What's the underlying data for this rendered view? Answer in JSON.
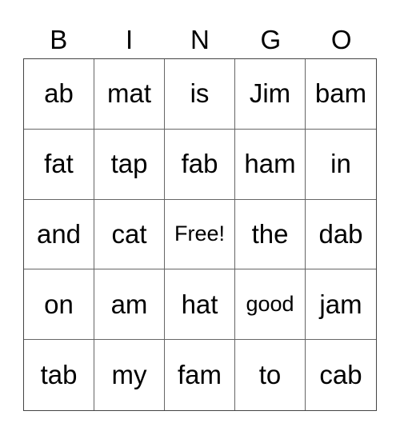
{
  "header": [
    "B",
    "I",
    "N",
    "G",
    "O"
  ],
  "rows": [
    [
      "ab",
      "mat",
      "is",
      "Jim",
      "bam"
    ],
    [
      "fat",
      "tap",
      "fab",
      "ham",
      "in"
    ],
    [
      "and",
      "cat",
      "Free!",
      "the",
      "dab"
    ],
    [
      "on",
      "am",
      "hat",
      "good",
      "jam"
    ],
    [
      "tab",
      "my",
      "fam",
      "to",
      "cab"
    ]
  ]
}
